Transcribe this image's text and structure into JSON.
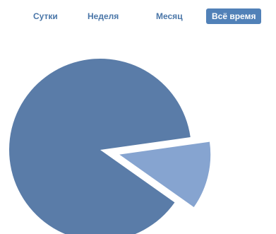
{
  "tabs": [
    {
      "label": "Сутки",
      "active": false
    },
    {
      "label": "Неделя",
      "active": false
    },
    {
      "label": "Месяц",
      "active": false
    },
    {
      "label": "Всё время",
      "active": true
    }
  ],
  "colors": {
    "tab_text": "#4a76a8",
    "tab_active_bg": "#5181b8",
    "tab_active_text": "#ffffff",
    "slice_main": "#5a7ca8",
    "slice_minor": "#86a4d0"
  },
  "chart_data": {
    "type": "pie",
    "title": "",
    "slices": [
      {
        "value": 88,
        "color": "#5a7ca8",
        "exploded": false
      },
      {
        "value": 12,
        "color": "#86a4d0",
        "exploded": true
      }
    ],
    "legend": "none"
  }
}
